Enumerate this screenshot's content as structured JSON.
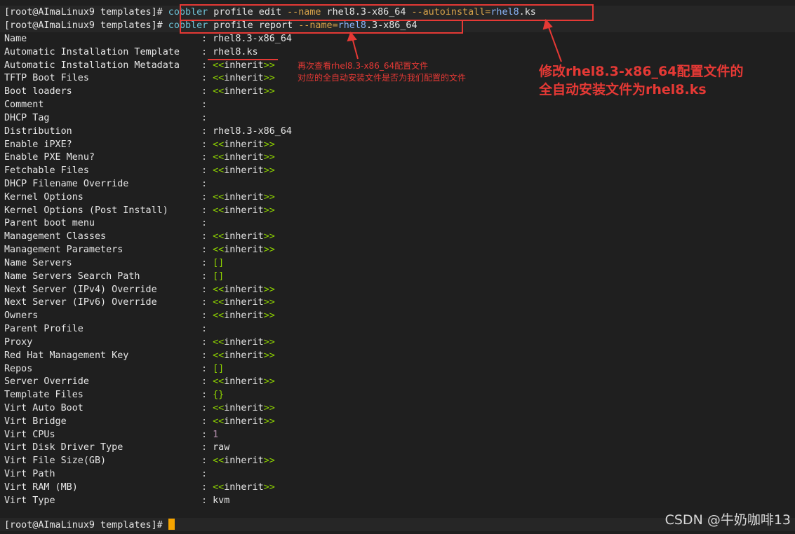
{
  "terminal": {
    "prompt": "[root@AImaLinux9 templates]# ",
    "command1": {
      "cmd": "cobbler",
      "rest": " profile edit ",
      "opt1": "--name",
      "arg1": " rhel8.3-x86_64 ",
      "opt2": "--autoinstall",
      "eq": "=",
      "arg2_blue": "rhel8",
      "arg2_rest": ".ks"
    },
    "command2": {
      "cmd": "cobbler",
      "rest": " profile report ",
      "opt1": "--name",
      "eq": "=",
      "arg_blue": "rhel8",
      "arg_rest": ".3-x86_64"
    },
    "report": [
      {
        "label": "Name",
        "value": "rhel8.3-x86_64",
        "kind": "plain"
      },
      {
        "label": "Automatic Installation Template",
        "value": "rhel8.ks",
        "kind": "plain"
      },
      {
        "label": "Automatic Installation Metadata",
        "value": "inherit",
        "kind": "inherit"
      },
      {
        "label": "TFTP Boot Files",
        "value": "inherit",
        "kind": "inherit"
      },
      {
        "label": "Boot loaders",
        "value": "inherit",
        "kind": "inherit"
      },
      {
        "label": "Comment",
        "value": "",
        "kind": "plain"
      },
      {
        "label": "DHCP Tag",
        "value": "",
        "kind": "plain"
      },
      {
        "label": "Distribution",
        "value": "rhel8.3-x86_64",
        "kind": "plain"
      },
      {
        "label": "Enable iPXE?",
        "value": "inherit",
        "kind": "inherit"
      },
      {
        "label": "Enable PXE Menu?",
        "value": "inherit",
        "kind": "inherit"
      },
      {
        "label": "Fetchable Files",
        "value": "inherit",
        "kind": "inherit"
      },
      {
        "label": "DHCP Filename Override",
        "value": "",
        "kind": "plain"
      },
      {
        "label": "Kernel Options",
        "value": "inherit",
        "kind": "inherit"
      },
      {
        "label": "Kernel Options (Post Install)",
        "value": "inherit",
        "kind": "inherit"
      },
      {
        "label": "Parent boot menu",
        "value": "",
        "kind": "plain"
      },
      {
        "label": "Management Classes",
        "value": "inherit",
        "kind": "inherit"
      },
      {
        "label": "Management Parameters",
        "value": "inherit",
        "kind": "inherit"
      },
      {
        "label": "Name Servers",
        "value": "[]",
        "kind": "green"
      },
      {
        "label": "Name Servers Search Path",
        "value": "[]",
        "kind": "green"
      },
      {
        "label": "Next Server (IPv4) Override",
        "value": "inherit",
        "kind": "inherit"
      },
      {
        "label": "Next Server (IPv6) Override",
        "value": "inherit",
        "kind": "inherit"
      },
      {
        "label": "Owners",
        "value": "inherit",
        "kind": "inherit"
      },
      {
        "label": "Parent Profile",
        "value": "",
        "kind": "plain"
      },
      {
        "label": "Proxy",
        "value": "inherit",
        "kind": "inherit"
      },
      {
        "label": "Red Hat Management Key",
        "value": "inherit",
        "kind": "inherit"
      },
      {
        "label": "Repos",
        "value": "[]",
        "kind": "green"
      },
      {
        "label": "Server Override",
        "value": "inherit",
        "kind": "inherit"
      },
      {
        "label": "Template Files",
        "value": "{}",
        "kind": "green"
      },
      {
        "label": "Virt Auto Boot",
        "value": "inherit",
        "kind": "inherit"
      },
      {
        "label": "Virt Bridge",
        "value": "inherit",
        "kind": "inherit"
      },
      {
        "label": "Virt CPUs",
        "value": "1",
        "kind": "purple"
      },
      {
        "label": "Virt Disk Driver Type",
        "value": "raw",
        "kind": "plain"
      },
      {
        "label": "Virt File Size(GB)",
        "value": "inherit",
        "kind": "inherit"
      },
      {
        "label": "Virt Path",
        "value": "",
        "kind": "plain"
      },
      {
        "label": "Virt RAM (MB)",
        "value": "inherit",
        "kind": "inherit"
      },
      {
        "label": "Virt Type",
        "value": "kvm",
        "kind": "plain"
      }
    ],
    "inherit_open": "<<",
    "inherit_close": ">>",
    "colon": ": "
  },
  "annotations": {
    "small_line1": "再次查看rhel8.3-x86_64配置文件",
    "small_line2": "对应的全自动安装文件是否为我们配置的文件",
    "big_line1": "修改rhel8.3-x86_64配置文件的",
    "big_line2": "全自动安装文件为rhel8.ks"
  },
  "watermark": "CSDN @牛奶咖啡13",
  "colors": {
    "background": "#1f1f1f",
    "annotation_red": "#e53935",
    "cursor": "#f5a400",
    "inherit_green": "#8fd400",
    "command_cyan": "#6ec2d6",
    "option_orange": "#d7a24a"
  }
}
